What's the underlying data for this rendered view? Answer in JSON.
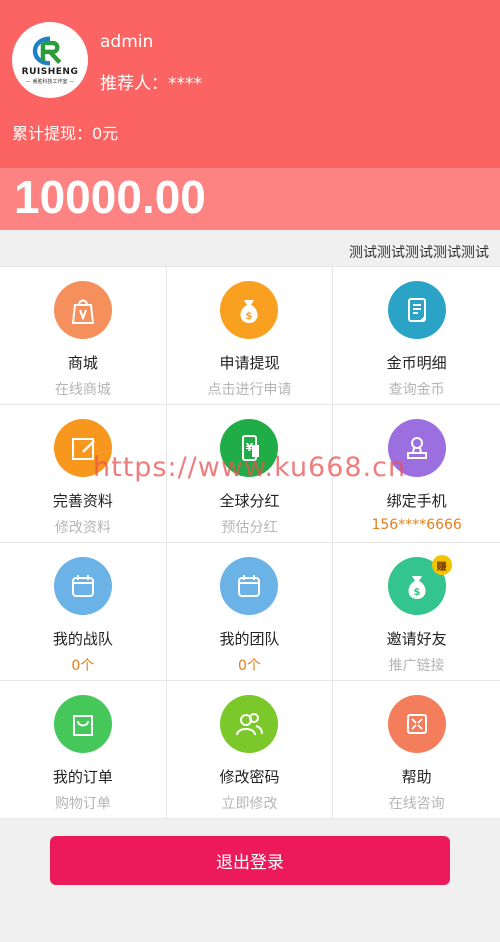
{
  "profile": {
    "brand_name": "RUISHENG",
    "brand_sub": "— 睿胜科技工作室 —",
    "username": "admin",
    "referrer": "推荐人：****",
    "total_withdraw": "累计提现：0元",
    "balance": "10000.00"
  },
  "notice": {
    "text": "测试测试测试测试测试"
  },
  "colors": {
    "header": "#fb6462",
    "balance_band": "#fc8382",
    "logout": "#ec1a5b",
    "orange_text": "#e57f1e"
  },
  "menu": [
    {
      "title": "商城",
      "sub": "在线商城",
      "icon": "shopping-bag-icon",
      "color": "#f5905c"
    },
    {
      "title": "申请提现",
      "sub": "点击进行申请",
      "icon": "money-bag-icon",
      "color": "#f9a021"
    },
    {
      "title": "金币明细",
      "sub": "查询金币",
      "icon": "document-icon",
      "color": "#2aa3c7"
    },
    {
      "title": "完善资料",
      "sub": "修改资料",
      "icon": "edit-icon",
      "color": "#f7971e"
    },
    {
      "title": "全球分红",
      "sub": "预估分红",
      "icon": "phone-yuan-icon",
      "color": "#20ad47"
    },
    {
      "title": "绑定手机",
      "sub": "156****6666",
      "icon": "user-stamp-icon",
      "color": "#9b6fe0"
    },
    {
      "title": "我的战队",
      "sub": "0个",
      "icon": "calendar-icon",
      "color": "#6bb2e6"
    },
    {
      "title": "我的团队",
      "sub": "0个",
      "icon": "calendar-icon",
      "color": "#6bb2e6"
    },
    {
      "title": "邀请好友",
      "sub": "推广链接",
      "icon": "invite-moneybag-icon",
      "color": "#33c48f",
      "badge": "赚"
    },
    {
      "title": "我的订单",
      "sub": "购物订单",
      "icon": "bag-icon",
      "color": "#45c75a"
    },
    {
      "title": "修改密码",
      "sub": "立即修改",
      "icon": "users-icon",
      "color": "#7bc82b"
    },
    {
      "title": "帮助",
      "sub": "在线咨询",
      "icon": "expand-icon",
      "color": "#f47e5c"
    }
  ],
  "watermark": "https://www.ku668.cn",
  "logout_label": "退出登录"
}
